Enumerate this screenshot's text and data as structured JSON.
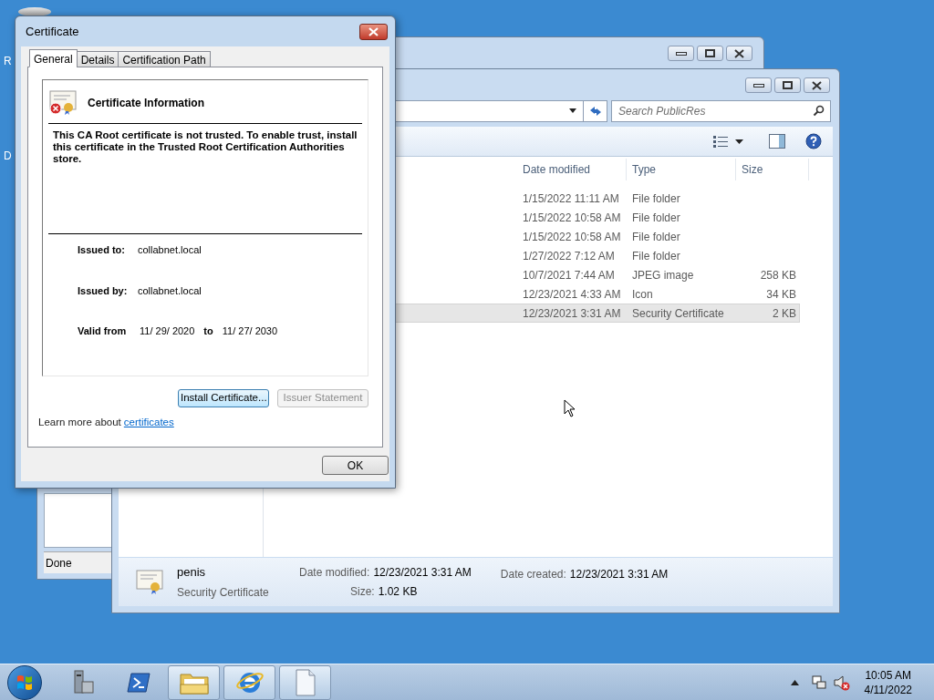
{
  "desktop": {
    "icon_labels": [
      "R",
      "D"
    ]
  },
  "background_window": {
    "status": "Done"
  },
  "explorer": {
    "search": {
      "placeholder": "Search PublicRes"
    },
    "columns": [
      "Date modified",
      "Type",
      "Size"
    ],
    "rows": [
      {
        "date_modified": "1/15/2022 11:11 AM",
        "type": "File folder",
        "size": "",
        "selected": false
      },
      {
        "date_modified": "1/15/2022 10:58 AM",
        "type": "File folder",
        "size": "",
        "selected": false
      },
      {
        "date_modified": "1/15/2022 10:58 AM",
        "type": "File folder",
        "size": "",
        "selected": false
      },
      {
        "date_modified": "1/27/2022 7:12 AM",
        "type": "File folder",
        "size": "",
        "selected": false
      },
      {
        "date_modified": "10/7/2021 7:44 AM",
        "type": "JPEG image",
        "size": "258 KB",
        "selected": false
      },
      {
        "date_modified": "12/23/2021 4:33 AM",
        "type": "Icon",
        "size": "34 KB",
        "selected": false
      },
      {
        "date_modified": "12/23/2021 3:31 AM",
        "type": "Security Certificate",
        "size": "2 KB",
        "selected": true
      }
    ],
    "details": {
      "name": "penis",
      "type": "Security Certificate",
      "date_modified_label": "Date modified:",
      "date_modified": "12/23/2021 3:31 AM",
      "date_created_label": "Date created:",
      "date_created": "12/23/2021 3:31 AM",
      "size_label": "Size:",
      "size": "1.02 KB"
    }
  },
  "certificate_dialog": {
    "title": "Certificate",
    "tabs": [
      {
        "label": "General",
        "selected": true
      },
      {
        "label": "Details",
        "selected": false
      },
      {
        "label": "Certification Path",
        "selected": false
      }
    ],
    "heading": "Certificate Information",
    "message": "This CA Root certificate is not trusted. To enable trust, install this certificate in the Trusted Root Certification Authorities store.",
    "issued_to_label": "Issued to:",
    "issued_to": "collabnet.local",
    "issued_by_label": "Issued by:",
    "issued_by": "collabnet.local",
    "valid_from_label": "Valid from",
    "valid_from": "11/ 29/ 2020",
    "to_label": "to",
    "valid_to": "11/ 27/ 2030",
    "buttons": [
      {
        "label": "Install Certificate...",
        "disabled": false
      },
      {
        "label": "Issuer Statement",
        "disabled": true
      }
    ],
    "learn_more": "Learn more about",
    "link": "certificates",
    "ok": "OK"
  },
  "taskbar": {
    "apps": [
      {
        "kind": "server",
        "active": false
      },
      {
        "kind": "shell",
        "active": false
      },
      {
        "kind": "folder",
        "active": true
      },
      {
        "kind": "browser",
        "active": true
      },
      {
        "kind": "document",
        "active": true
      }
    ],
    "clock": {
      "time": "10:05 AM",
      "date": "4/11/2022"
    }
  }
}
